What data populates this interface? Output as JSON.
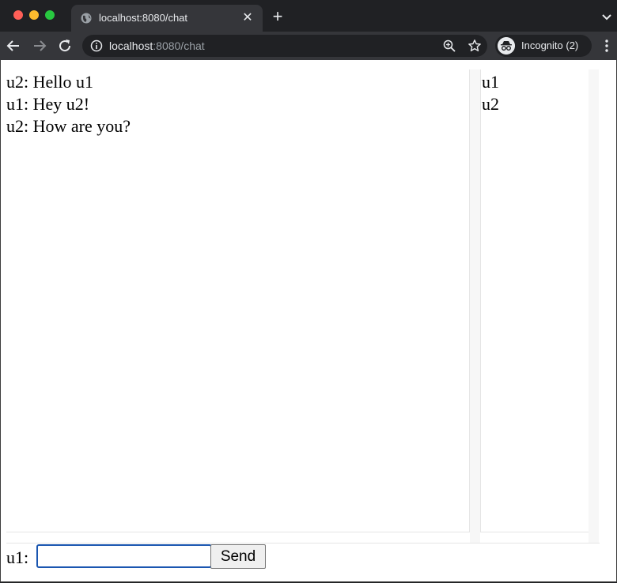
{
  "browser": {
    "tab_title": "localhost:8080/chat",
    "url_host": "localhost",
    "url_rest": ":8080/chat",
    "incognito_label": "Incognito (2)"
  },
  "chat": {
    "messages": [
      {
        "text": "u2: Hello u1"
      },
      {
        "text": "u1: Hey u2!"
      },
      {
        "text": "u2: How are you?"
      }
    ],
    "users": [
      "u1",
      "u2"
    ],
    "compose": {
      "label": "u1:",
      "value": "",
      "send_label": "Send"
    }
  },
  "colors": {
    "chrome_dark": "#202124",
    "toolbar": "#35363a",
    "focus_ring": "#1a56b0"
  }
}
